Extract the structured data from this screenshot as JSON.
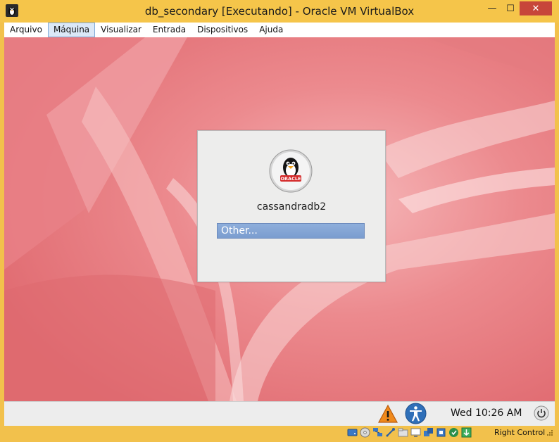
{
  "window": {
    "title": "db_secondary [Executando] - Oracle VM VirtualBox",
    "minimize_glyph": "—",
    "maximize_glyph": "☐",
    "close_glyph": "✕"
  },
  "menu": {
    "items": [
      {
        "label": "Arquivo",
        "active": false
      },
      {
        "label": "Máquina",
        "active": true
      },
      {
        "label": "Visualizar",
        "active": false
      },
      {
        "label": "Entrada",
        "active": false
      },
      {
        "label": "Dispositivos",
        "active": false
      },
      {
        "label": "Ajuda",
        "active": false
      }
    ]
  },
  "login": {
    "username": "cassandradb2",
    "other_label": "Other...",
    "avatar_badge": "ORACLE"
  },
  "panel": {
    "clock": "Wed 10:26 AM"
  },
  "statusbar": {
    "host_key": "Right Control",
    "icons": [
      "hard-disk-icon",
      "optical-drive-icon",
      "network-icon",
      "usb-icon",
      "shared-folders-icon",
      "display-icon",
      "video-capture-icon",
      "cpu-icon",
      "mouse-integration-icon",
      "keyboard-capture-icon"
    ]
  },
  "colors": {
    "frame": "#f2c14c",
    "desktop": "#e8747a",
    "accent": "#7b9dcf",
    "close": "#c7463a"
  }
}
